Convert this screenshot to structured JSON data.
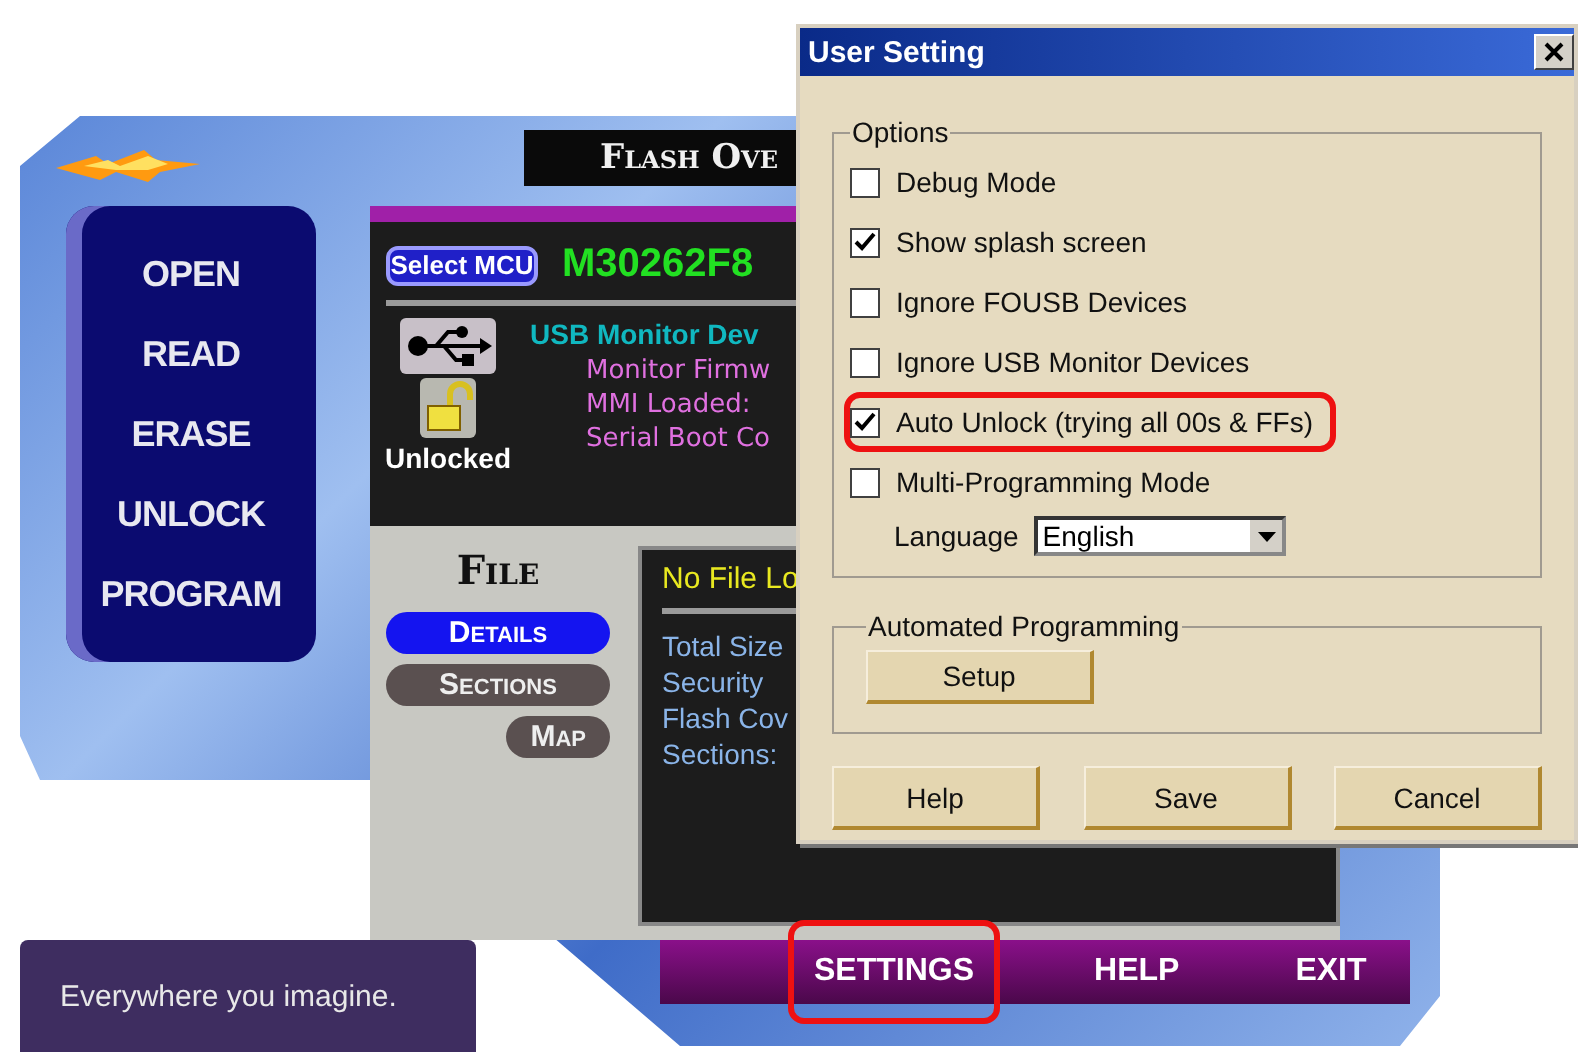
{
  "app": {
    "title_banner": "Flash Ove",
    "nav_items": [
      "OPEN",
      "READ",
      "ERASE",
      "UNLOCK",
      "PROGRAM"
    ],
    "device": {
      "select_button": "Select MCU",
      "mcu": "M30262F8",
      "monitor_title": "USB Monitor Dev",
      "lock_label": "Unlocked",
      "details": [
        "Monitor Firmw",
        "MMI Loaded:",
        "Serial Boot Co"
      ]
    },
    "file": {
      "heading": "File",
      "tabs": [
        {
          "label": "Details",
          "selected": true
        },
        {
          "label": "Sections",
          "selected": false
        },
        {
          "label": "Map",
          "selected": false
        }
      ],
      "status": "No File Lo",
      "fields": [
        "Total Size",
        "Security",
        "Flash Cov",
        "Sections:"
      ]
    },
    "bottom_bar": [
      {
        "label": "SETTINGS",
        "highlighted": true
      },
      {
        "label": "HELP",
        "highlighted": false
      },
      {
        "label": "EXIT",
        "highlighted": false
      }
    ]
  },
  "tagline": "Everywhere you imagine.",
  "dialog": {
    "title": "User Setting",
    "options_group": {
      "legend": "Options",
      "options": [
        {
          "label": "Debug Mode",
          "checked": false,
          "highlighted": false
        },
        {
          "label": "Show splash screen",
          "checked": true,
          "highlighted": false
        },
        {
          "label": "Ignore FOUSB Devices",
          "checked": false,
          "highlighted": false
        },
        {
          "label": "Ignore USB Monitor Devices",
          "checked": false,
          "highlighted": false
        },
        {
          "label": "Auto Unlock (trying all 00s & FFs)",
          "checked": true,
          "highlighted": true
        },
        {
          "label": "Multi-Programming Mode",
          "checked": false,
          "highlighted": false
        }
      ],
      "language": {
        "label": "Language",
        "value": "English"
      }
    },
    "automation_group": {
      "legend": "Automated Programming",
      "button": "Setup"
    },
    "buttons": [
      "Help",
      "Save",
      "Cancel"
    ]
  }
}
